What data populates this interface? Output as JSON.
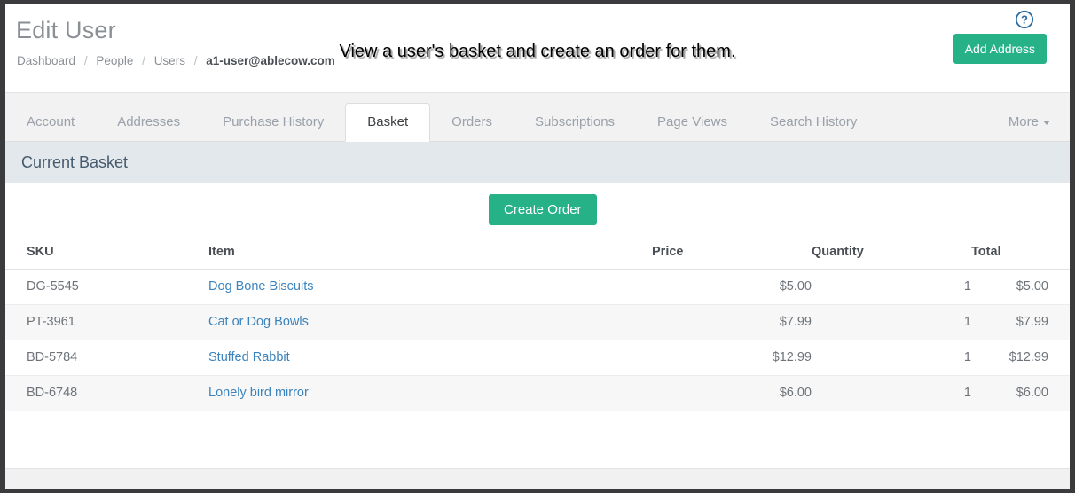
{
  "header": {
    "title": "Edit User",
    "breadcrumb": [
      {
        "label": "Dashboard",
        "current": false
      },
      {
        "label": "People",
        "current": false
      },
      {
        "label": "Users",
        "current": false
      },
      {
        "label": "a1-user@ablecow.com",
        "current": true
      }
    ],
    "separator": "/",
    "add_address_label": "Add Address",
    "help_icon": "help-circle-icon"
  },
  "caption": {
    "text": "View a user's basket and create an order for them."
  },
  "tabs": [
    {
      "label": "Account",
      "active": false
    },
    {
      "label": "Addresses",
      "active": false
    },
    {
      "label": "Purchase History",
      "active": false
    },
    {
      "label": "Basket",
      "active": true
    },
    {
      "label": "Orders",
      "active": false
    },
    {
      "label": "Subscriptions",
      "active": false
    },
    {
      "label": "Page Views",
      "active": false
    },
    {
      "label": "Search History",
      "active": false
    }
  ],
  "more_menu": {
    "label": "More",
    "icon": "chevron-down-icon"
  },
  "panel": {
    "heading": "Current Basket",
    "create_order_label": "Create Order"
  },
  "table": {
    "columns": [
      "SKU",
      "Item",
      "Price",
      "Quantity",
      "Total"
    ],
    "rows": [
      {
        "sku": "DG-5545",
        "item": "Dog Bone Biscuits",
        "price": "$5.00",
        "quantity": "1",
        "total": "$5.00"
      },
      {
        "sku": "PT-3961",
        "item": "Cat or Dog Bowls",
        "price": "$7.99",
        "quantity": "1",
        "total": "$7.99"
      },
      {
        "sku": "BD-5784",
        "item": "Stuffed Rabbit",
        "price": "$12.99",
        "quantity": "1",
        "total": "$12.99"
      },
      {
        "sku": "BD-6748",
        "item": "Lonely bird mirror",
        "price": "$6.00",
        "quantity": "1",
        "total": "$6.00"
      }
    ]
  },
  "colors": {
    "brand_green": "#26b186",
    "link_blue": "#3b83bd",
    "panel_heading_bg": "#e3e8ec",
    "panel_heading_text": "#465a6e",
    "frame": "#3b3b3d",
    "help_blue": "#2d6ca2"
  }
}
